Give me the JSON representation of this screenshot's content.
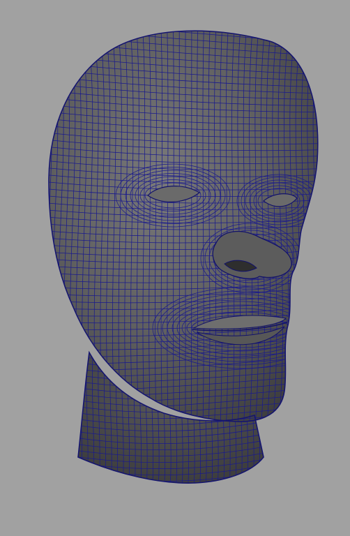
{
  "viewport": {
    "background_color": "#a1a1a1",
    "mesh_fill_color": "#5f5f5f",
    "mesh_fill_dark": "#3e3e3e",
    "mesh_fill_light": "#7a7a7a",
    "wireframe_color": "#1a1a8c",
    "object": "head-mesh"
  }
}
